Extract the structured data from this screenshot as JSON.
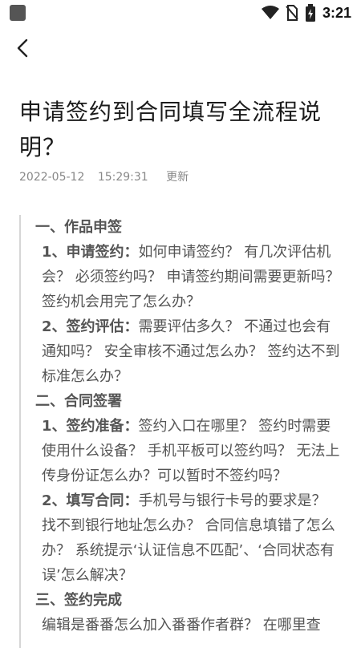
{
  "status_bar": {
    "time": "3:21",
    "icons": [
      "app-icon",
      "wifi-icon",
      "no-sim-icon",
      "battery-charging-icon"
    ]
  },
  "nav": {
    "back_icon": "chevron-left-icon"
  },
  "article": {
    "title": "申请签约到合同填写全流程说明？",
    "date": "2022-05-12",
    "time": "15:29:31",
    "updated_label": "更新",
    "sections": [
      {
        "heading": "一、作品申签",
        "items": [
          {
            "label": "1、申请签约：",
            "text": "如何申请签约？ 有几次评估机会？ 必须签约吗？ 申请签约期间需要更新吗？ 签约机会用完了怎么办？"
          },
          {
            "label": "2、签约评估：",
            "text": "需要评估多久？ 不通过也会有通知吗？ 安全审核不通过怎么办？ 签约达不到标准怎么办？"
          }
        ]
      },
      {
        "heading": "二、合同签署",
        "items": [
          {
            "label": "1、签约准备：",
            "text": "签约入口在哪里？ 签约时需要使用什么设备？ 手机平板可以签约吗？ 无法上传身份证怎么办？可以暂时不签约吗？"
          },
          {
            "label": "2、填写合同：",
            "text": "手机号与银行卡号的要求是？ 找不到银行地址怎么办？ 合同信息填错了怎么办？ 系统提示‘认证信息不匹配’、‘合同状态有误’怎么解决？"
          }
        ]
      },
      {
        "heading": "三、签约完成",
        "paragraph": "编辑是番番怎么加入番番作者群？ 在哪里查"
      }
    ]
  },
  "colors": {
    "text_primary": "#1a1a1a",
    "text_body": "#555555",
    "text_meta": "#888888",
    "quote_bar": "#d6d6d6"
  }
}
